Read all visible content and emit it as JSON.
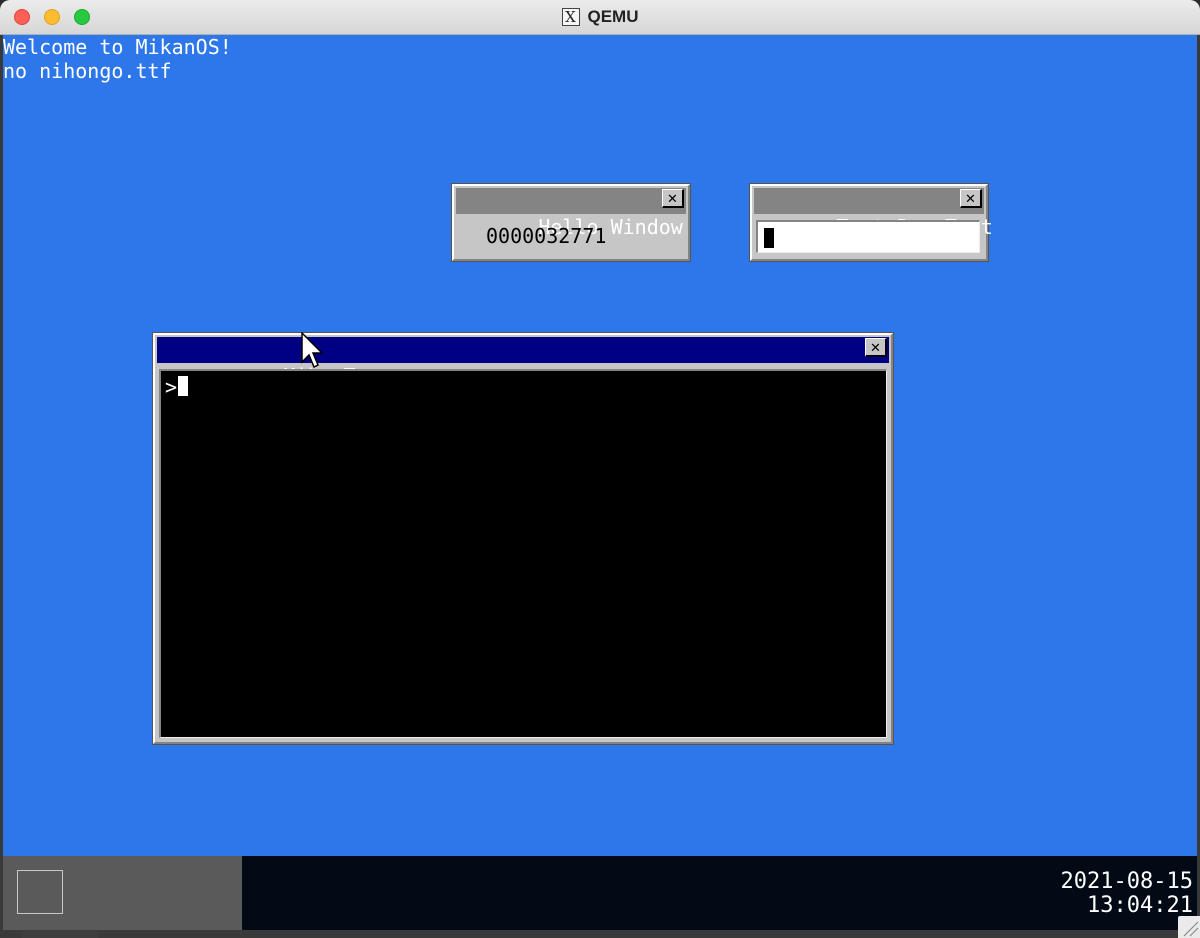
{
  "app": {
    "title": "QEMU",
    "titlebar_icon": "x11-icon",
    "titlebar_icon_glyph": "X"
  },
  "console": {
    "lines": [
      "Welcome to MikanOS!",
      "no nihongo.ttf"
    ]
  },
  "hello_window": {
    "title": "Hello Window",
    "counter": "0000032771",
    "close_glyph": "✕"
  },
  "textbox_window": {
    "title": "Text Box Test",
    "value": "",
    "close_glyph": "✕"
  },
  "terminal": {
    "title": "MikanTerm",
    "prompt": ">",
    "close_glyph": "✕"
  },
  "taskbar": {
    "date": "2021-08-15",
    "time": "13:04:21"
  },
  "colors": {
    "desktop": "#2d77ea",
    "taskbar": "#020a16",
    "window_body": "#c6c6c6",
    "active_title": "#000084",
    "inactive_title": "#848484",
    "terminal_bg": "#000000"
  }
}
